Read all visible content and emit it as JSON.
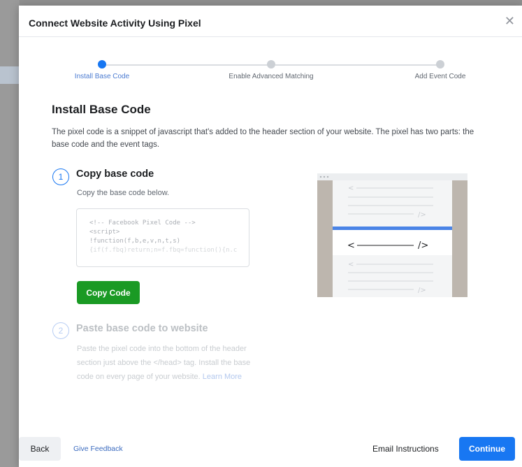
{
  "dialog": {
    "title": "Connect Website Activity Using Pixel",
    "close_icon": "close-icon"
  },
  "stepper": {
    "steps": [
      {
        "label": "Install Base Code",
        "state": "active"
      },
      {
        "label": "Enable Advanced Matching",
        "state": "inactive"
      },
      {
        "label": "Add Event Code",
        "state": "inactive"
      }
    ]
  },
  "content": {
    "title": "Install Base Code",
    "description": "The pixel code is a snippet of javascript that's added to the header section of your website. The pixel has two parts: the base code and the event tags.",
    "step1": {
      "number": "1",
      "title": "Copy base code",
      "subtitle": "Copy the base code below.",
      "code_lines": [
        "<!-- Facebook Pixel Code -->",
        "<script>",
        "!function(f,b,e,v,n,t,s)",
        "{if(f.fbq)return;n=f.fbq=function(){n.c"
      ],
      "copy_button": "Copy Code"
    },
    "step2": {
      "number": "2",
      "title": "Paste base code to website",
      "subtitle": "Paste the pixel code into the bottom of the header section just above the </head> tag. Install the base code on every page of your website.",
      "learn_more": "Learn More"
    },
    "illustration": {
      "icon": "code-brackets-illustration",
      "tag": "</>"
    }
  },
  "footer": {
    "back": "Back",
    "feedback": "Give Feedback",
    "email": "Email Instructions",
    "continue": "Continue"
  },
  "colors": {
    "accent": "#1877f2",
    "copy_button": "#1a9a24"
  }
}
